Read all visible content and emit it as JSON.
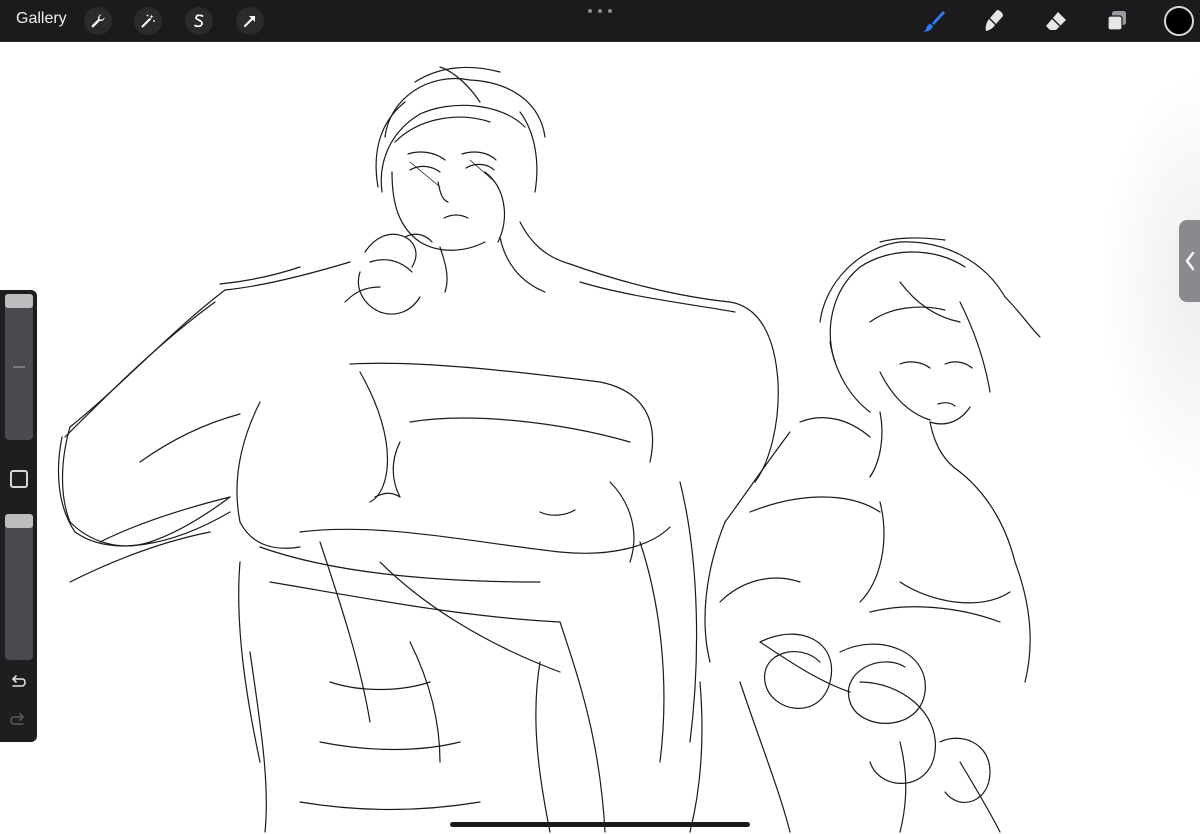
{
  "topbar": {
    "gallery_label": "Gallery",
    "left_tools": [
      {
        "name": "actions",
        "icon": "wrench-icon"
      },
      {
        "name": "adjustments",
        "icon": "magic-wand-icon"
      },
      {
        "name": "selection",
        "icon": "selection-s-icon"
      },
      {
        "name": "transform",
        "icon": "arrow-cursor-icon"
      }
    ],
    "more_icon": "more-dots-icon",
    "right_tools": [
      {
        "name": "brush",
        "icon": "brush-icon",
        "active": true
      },
      {
        "name": "smudge",
        "icon": "smudge-icon",
        "active": false
      },
      {
        "name": "eraser",
        "icon": "eraser-icon",
        "active": false
      },
      {
        "name": "layers",
        "icon": "layers-icon",
        "active": false
      }
    ],
    "current_color": "#000000",
    "active_tool_color": "#2f7cf6"
  },
  "sidebar": {
    "brush_size_level": 0.0,
    "opacity_level": 0.0,
    "modify_icon": "square-modify-icon",
    "undo_icon": "undo-icon",
    "redo_icon": "redo-icon"
  },
  "side_tab_icon": "chevron-left-icon"
}
